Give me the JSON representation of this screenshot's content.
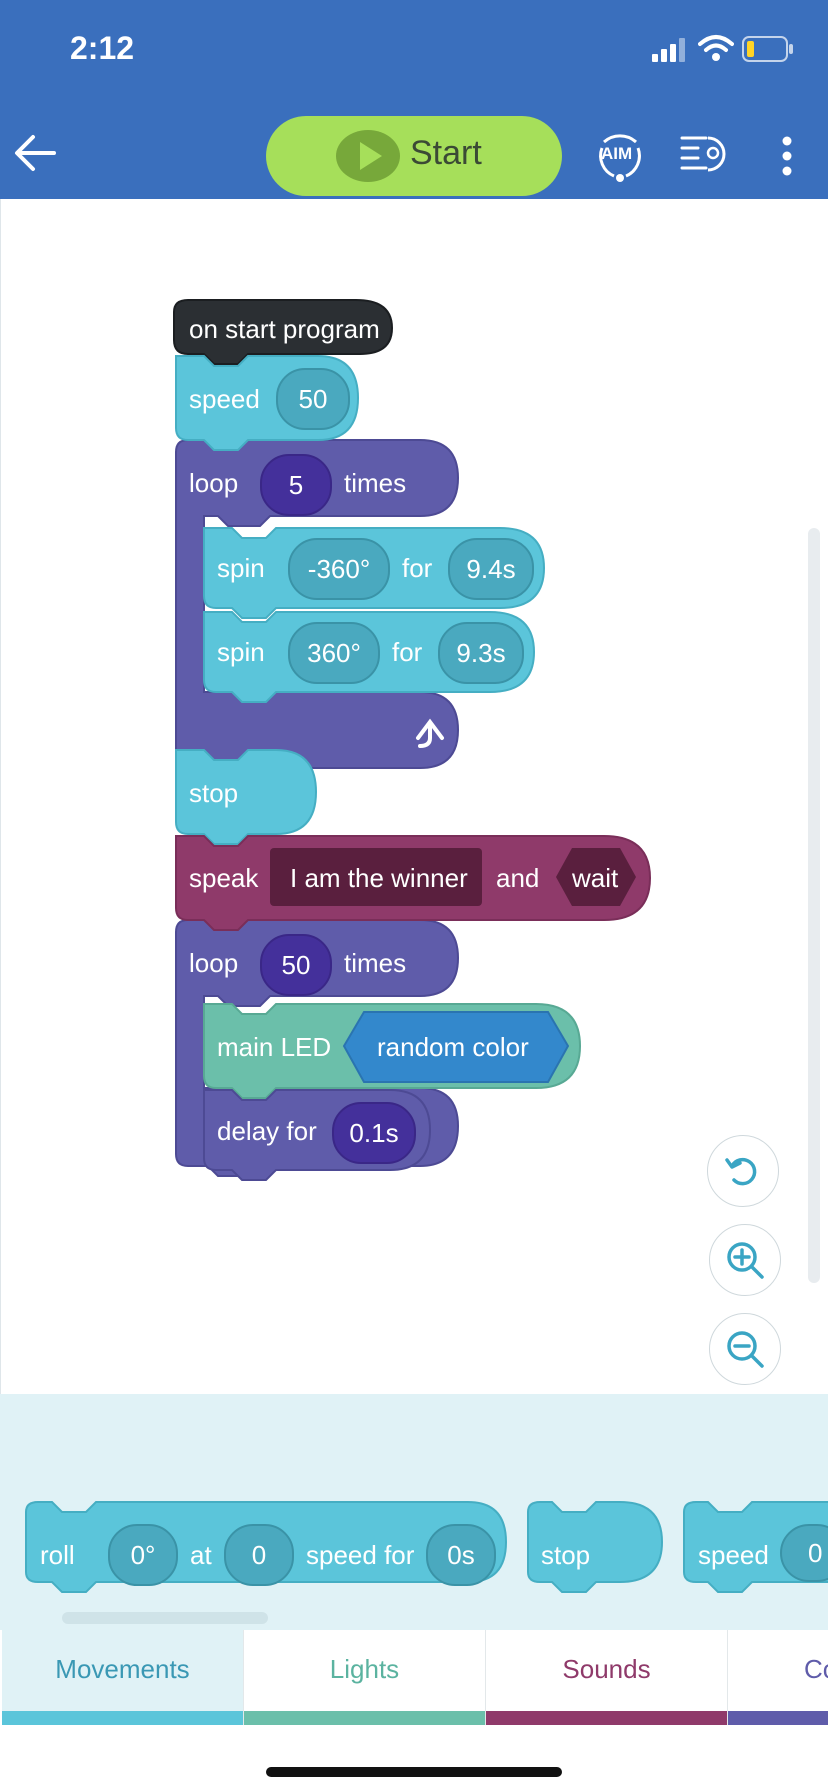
{
  "status_bar": {
    "time": "2:12"
  },
  "toolbar": {
    "start_label": "Start",
    "aim_label": "AIM"
  },
  "program": {
    "on_start": "on start program",
    "speed": {
      "label": "speed",
      "value": "50"
    },
    "loop1": {
      "label": "loop",
      "count": "5",
      "suffix": "times",
      "spin1": {
        "label": "spin",
        "angle": "-360°",
        "for": "for",
        "duration": "9.4s"
      },
      "spin2": {
        "label": "spin",
        "angle": "360°",
        "for": "for",
        "duration": "9.3s"
      }
    },
    "stop": "stop",
    "speak": {
      "label": "speak",
      "text": "I am the winner",
      "and": "and",
      "wait": "wait"
    },
    "loop2": {
      "label": "loop",
      "count": "50",
      "suffix": "times",
      "led": {
        "label": "main LED",
        "value": "random color"
      },
      "delay": {
        "label": "delay for",
        "value": "0.1s"
      }
    }
  },
  "palette": {
    "roll": {
      "label": "roll",
      "angle": "0°",
      "at": "at",
      "speed": "0",
      "speed_for": "speed for",
      "duration": "0s"
    },
    "stop": "stop",
    "speed": {
      "label": "speed",
      "value": "0"
    }
  },
  "tabs": [
    {
      "label": "Movements",
      "color": "#5bc5da",
      "text_color": "#3a98b4"
    },
    {
      "label": "Lights",
      "color": "#6bbfaa",
      "text_color": "#5bb3a0"
    },
    {
      "label": "Sounds",
      "color": "#8f3a6a",
      "text_color": "#8f3a6a"
    },
    {
      "label": "Co",
      "color": "#5f5caa",
      "text_color": "#5f5caa"
    }
  ],
  "colors": {
    "header": "#3a6fbd",
    "start": "#a6df5a",
    "movement_block": "#5bc5da",
    "control_block": "#5f5caa",
    "sound_block": "#8f3a6a",
    "light_block": "#6bbfaa",
    "event_block": "#2b2f33"
  }
}
